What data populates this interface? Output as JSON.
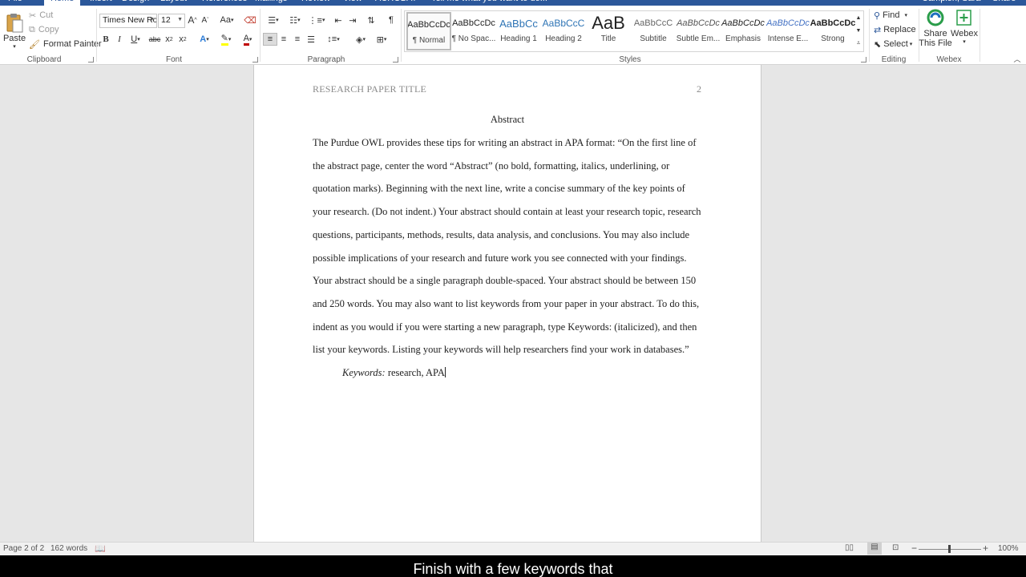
{
  "tabs": [
    {
      "label": "File",
      "active": false
    },
    {
      "label": "Home",
      "active": true
    },
    {
      "label": "Insert",
      "active": false
    },
    {
      "label": "Design",
      "active": false
    },
    {
      "label": "Layout",
      "active": false
    },
    {
      "label": "References",
      "active": false
    },
    {
      "label": "Mailings",
      "active": false
    },
    {
      "label": "Review",
      "active": false
    },
    {
      "label": "View",
      "active": false
    },
    {
      "label": "ACROBAT",
      "active": false
    },
    {
      "label": "Tell me what you want to do...",
      "active": false
    },
    {
      "label": "Campion, Sara",
      "active": false
    },
    {
      "label": "Share",
      "active": false
    }
  ],
  "clipboard": {
    "paste": "Paste",
    "cut": "Cut",
    "copy": "Copy",
    "format_painter": "Format Painter",
    "group": "Clipboard"
  },
  "font": {
    "family": "Times New Ro",
    "size": "12",
    "group": "Font"
  },
  "paragraph": {
    "group": "Paragraph"
  },
  "styles": {
    "group": "Styles",
    "items": [
      {
        "sample": "AaBbCcDc",
        "name": "¶ Normal"
      },
      {
        "sample": "AaBbCcDc",
        "name": "¶ No Spac..."
      },
      {
        "sample": "AaBbCc",
        "name": "Heading 1"
      },
      {
        "sample": "AaBbCcC",
        "name": "Heading 2"
      },
      {
        "sample": "AaB",
        "name": "Title"
      },
      {
        "sample": "AaBbCcC",
        "name": "Subtitle"
      },
      {
        "sample": "AaBbCcDc",
        "name": "Subtle Em..."
      },
      {
        "sample": "AaBbCcDc",
        "name": "Emphasis"
      },
      {
        "sample": "AaBbCcDc",
        "name": "Intense E..."
      },
      {
        "sample": "AaBbCcDc",
        "name": "Strong"
      }
    ]
  },
  "editing": {
    "find": "Find",
    "replace": "Replace",
    "select": "Select",
    "group": "Editing"
  },
  "webex": {
    "share": "Share",
    "this_file": "This File",
    "webex": "Webex",
    "group": "Webex"
  },
  "document": {
    "running_head": "RESEARCH PAPER TITLE",
    "page_number": "2",
    "title": "Abstract",
    "lines": [
      "The Purdue OWL provides these tips for writing an abstract in APA format: “On the first line of",
      "the abstract page, center the word “Abstract” (no bold, formatting, italics, underlining, or",
      "quotation marks). Beginning with the next line, write a concise summary of the key points of",
      "your research. (Do not indent.) Your abstract should contain at least your research topic, research",
      "questions, participants, methods, results, data analysis, and conclusions. You may also include",
      "possible implications of your research and future work you see connected with your findings.",
      "Your abstract should be a single paragraph double-spaced. Your abstract should be between 150",
      "and 250 words. You may also want to list keywords from your paper in your abstract. To do this,",
      "indent as you would if you were starting a new paragraph, type Keywords: (italicized), and then",
      "list your keywords. Listing your keywords will help researchers find your work in databases.”"
    ],
    "keywords_label": "Keywords:",
    "keywords_value": " research, APA"
  },
  "status": {
    "page": "Page 2 of 2",
    "words": "162 words",
    "zoom": "100%",
    "zoom_level": 1.0
  },
  "caption": "Finish with a few keywords that",
  "colors": {
    "ribbon_accent": "#2b579a",
    "font_color": "#c00000",
    "highlight": "#ffff00"
  }
}
